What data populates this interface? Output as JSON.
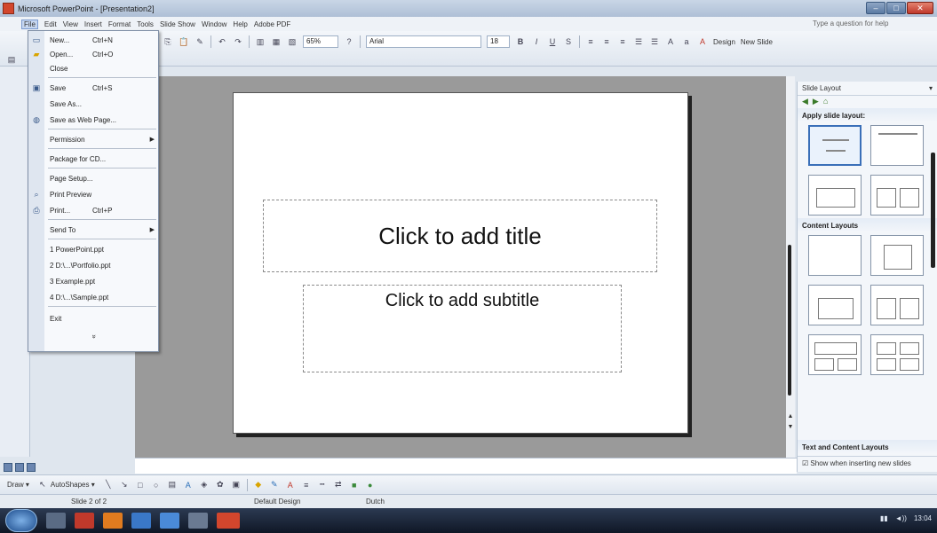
{
  "window": {
    "title": "Microsoft PowerPoint - [Presentation2]",
    "buttons": [
      "–",
      "□",
      "✕"
    ]
  },
  "menubar": {
    "items": [
      "File",
      "Edit",
      "View",
      "Insert",
      "Format",
      "Tools",
      "Slide Show",
      "Window",
      "Help",
      "Adobe PDF"
    ],
    "help_placeholder": "Type a question for help"
  },
  "toolbar": {
    "zoom": "65%",
    "font": "Arial",
    "font_size": "18",
    "design_label": "Design",
    "new_slide_label": "New Slide"
  },
  "file_menu": {
    "items": [
      {
        "label": "New...",
        "shortcut": "Ctrl+N",
        "icon": "new-file-icon"
      },
      {
        "label": "Open...",
        "shortcut": "Ctrl+O",
        "icon": "open-folder-icon"
      },
      {
        "label": "Close",
        "shortcut": "",
        "icon": ""
      },
      {
        "label": "Save",
        "shortcut": "Ctrl+S",
        "icon": "save-icon"
      },
      {
        "label": "Save As...",
        "shortcut": "",
        "icon": ""
      },
      {
        "label": "Save as Web Page...",
        "shortcut": "",
        "icon": "web-page-icon"
      },
      {
        "label": "Permission",
        "shortcut": "",
        "icon": "",
        "submenu": true
      },
      {
        "label": "Package for CD...",
        "shortcut": "",
        "icon": ""
      },
      {
        "label": "Page Setup...",
        "shortcut": "",
        "icon": ""
      },
      {
        "label": "Print Preview",
        "shortcut": "",
        "icon": "print-preview-icon"
      },
      {
        "label": "Print...",
        "shortcut": "Ctrl+P",
        "icon": "print-icon"
      },
      {
        "label": "Send To",
        "shortcut": "",
        "icon": "",
        "submenu": true
      },
      {
        "label": "1 PowerPoint.ppt",
        "shortcut": "",
        "icon": ""
      },
      {
        "label": "2 D:\\...\\Portfolio.ppt",
        "shortcut": "",
        "icon": ""
      },
      {
        "label": "3 Example.ppt",
        "shortcut": "",
        "icon": ""
      },
      {
        "label": "4 D:\\...\\Sample.ppt",
        "shortcut": "",
        "icon": ""
      },
      {
        "label": "Exit",
        "shortcut": "",
        "icon": ""
      }
    ],
    "expand_arrow": "»"
  },
  "slide": {
    "title_placeholder": "Click to add title",
    "subtitle_placeholder": "Click to add subtitle"
  },
  "task_pane": {
    "title": "Slide Layout",
    "section_apply": "Apply slide layout:",
    "section_content": "Content Layouts",
    "section_text_content": "Text and Content Layouts",
    "footer_checkbox": "Show when inserting new slides"
  },
  "drawbar": {
    "draw_label": "Draw ▾",
    "autoshapes_label": "AutoShapes ▾"
  },
  "statusbar": {
    "slide_info": "Slide 2 of 2",
    "design": "Default Design",
    "language": "Dutch"
  },
  "taskbar": {
    "time": "13:04"
  },
  "colors": {
    "accent": "#3a6fb8",
    "titlebar": "#aebfd6",
    "workspace": "#9a9a9a",
    "taskbar": "#0f1726"
  }
}
